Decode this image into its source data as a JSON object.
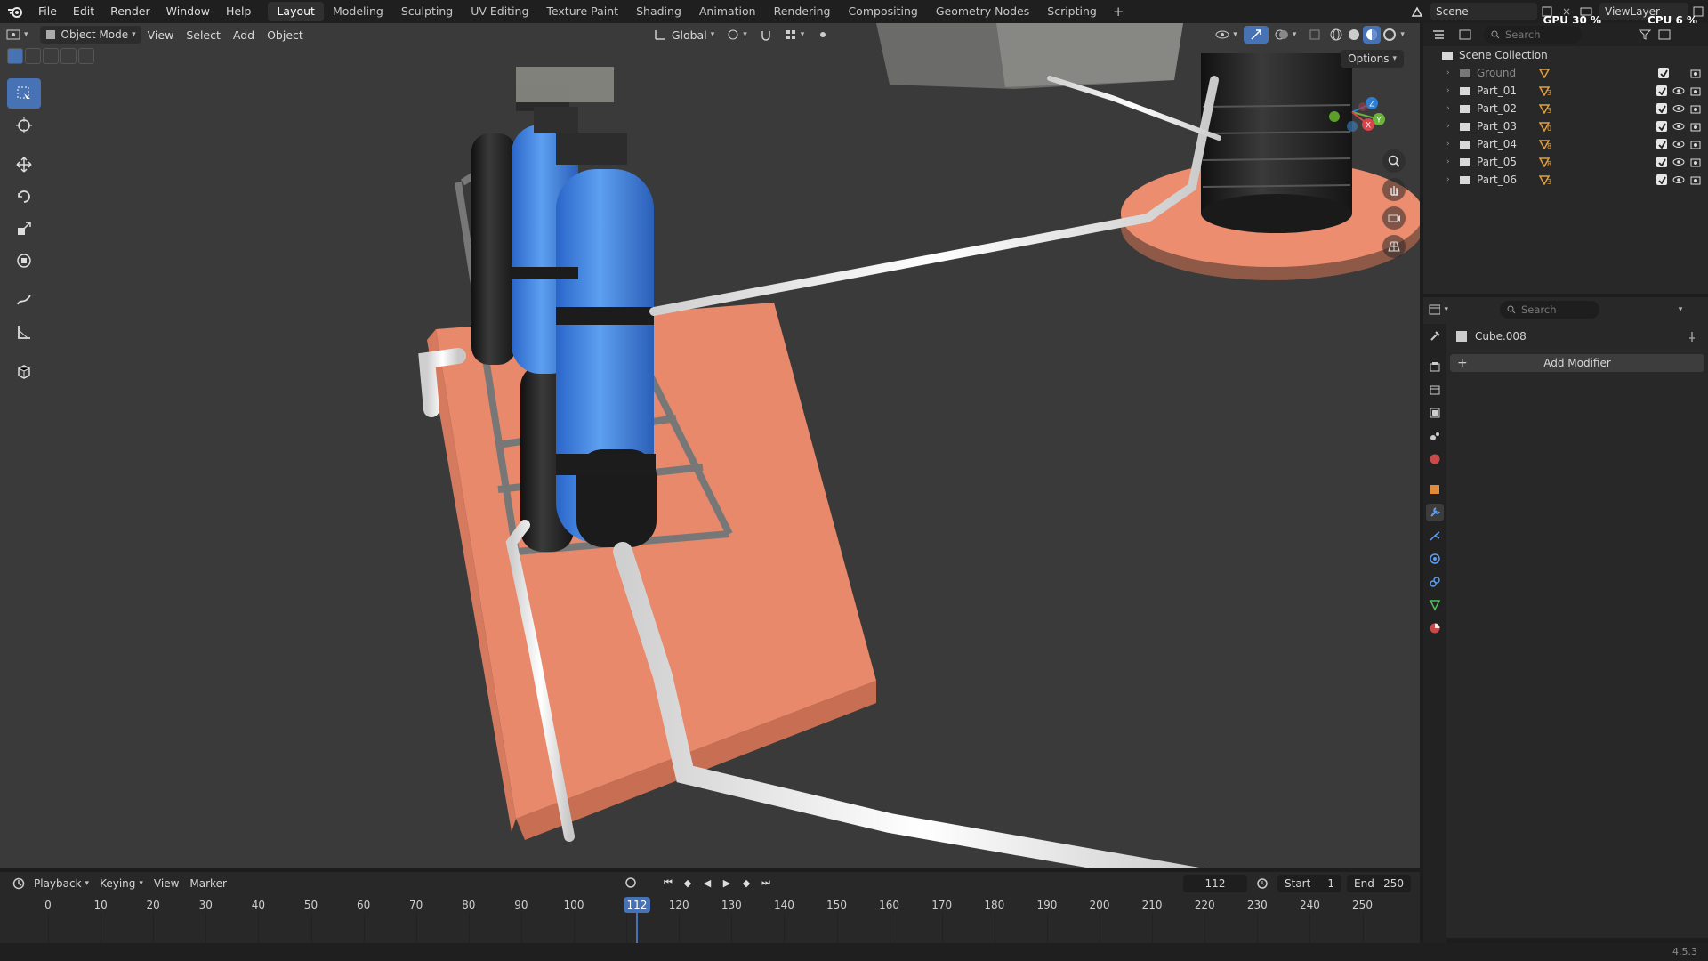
{
  "topbar": {
    "menus": [
      "File",
      "Edit",
      "Render",
      "Window",
      "Help"
    ],
    "workspaces": [
      "Layout",
      "Modeling",
      "Sculpting",
      "UV Editing",
      "Texture Paint",
      "Shading",
      "Animation",
      "Rendering",
      "Compositing",
      "Geometry Nodes",
      "Scripting"
    ],
    "active_workspace": "Layout",
    "scene_name": "Scene",
    "view_layer": "ViewLayer",
    "gpu_label": "GPU 30 %",
    "cpu_label": "CPU 6 %"
  },
  "viewport": {
    "mode": "Object Mode",
    "menus": [
      "View",
      "Select",
      "Add",
      "Object"
    ],
    "transform_orientation": "Global",
    "options_label": "Options",
    "tools": [
      "select-box-tool",
      "cursor-tool",
      "move-tool",
      "rotate-tool",
      "scale-tool",
      "transform-tool",
      "annotate-tool",
      "measure-tool",
      "add-cube-tool"
    ],
    "gizmo_axes": [
      "X",
      "Y",
      "Z"
    ]
  },
  "outliner": {
    "search_placeholder": "Search",
    "collection": "Scene Collection",
    "items": [
      {
        "name": "Ground",
        "badge": "",
        "visible": false
      },
      {
        "name": "Part_01",
        "badge": "3",
        "visible": true
      },
      {
        "name": "Part_02",
        "badge": "3",
        "visible": true
      },
      {
        "name": "Part_03",
        "badge": "0",
        "visible": true
      },
      {
        "name": "Part_04",
        "badge": "8",
        "visible": true
      },
      {
        "name": "Part_05",
        "badge": "8",
        "visible": true
      },
      {
        "name": "Part_06",
        "badge": "3",
        "visible": true
      }
    ]
  },
  "properties": {
    "search_placeholder": "Search",
    "object_name": "Cube.008",
    "add_modifier_label": "Add Modifier",
    "colors": {
      "accent": "#4772b3",
      "modifier_tab": "#5d9cf0"
    }
  },
  "timeline": {
    "menus": [
      "Playback",
      "Keying",
      "View",
      "Marker"
    ],
    "current_frame": "112",
    "start_label": "Start",
    "start_value": "1",
    "end_label": "End",
    "end_value": "250",
    "ticks": [
      "0",
      "10",
      "20",
      "30",
      "40",
      "50",
      "60",
      "70",
      "80",
      "90",
      "100",
      "1",
      "120",
      "130",
      "140",
      "150",
      "160",
      "170",
      "180",
      "190",
      "200",
      "210",
      "220",
      "230",
      "240",
      "250"
    ]
  },
  "statusbar": {
    "version": "4.5.3"
  }
}
